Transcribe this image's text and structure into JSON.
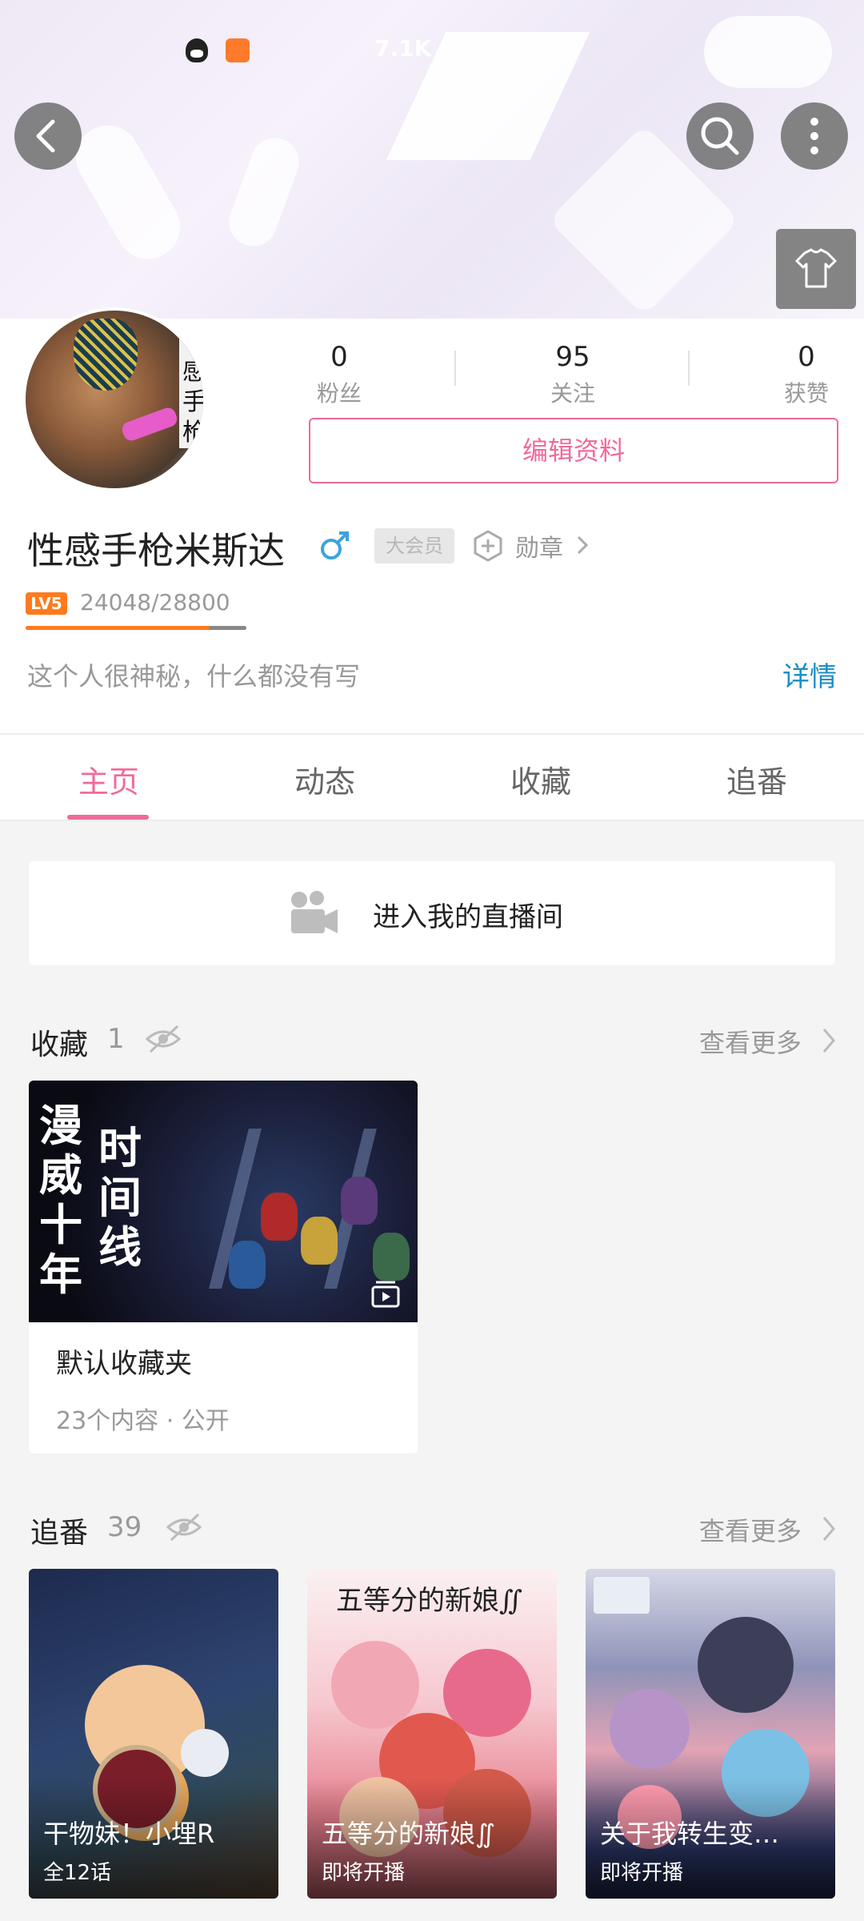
{
  "status_bar": {
    "text": "7.1K"
  },
  "profile": {
    "name": "性感手枪米斯达",
    "avatar_side_text": "♂感手枪",
    "stats": [
      {
        "value": "0",
        "label": "粉丝"
      },
      {
        "value": "95",
        "label": "关注"
      },
      {
        "value": "0",
        "label": "获赞"
      }
    ],
    "edit_label": "编辑资料",
    "vip_label": "大会员",
    "medal_label": "勋章",
    "level_label": "LV5",
    "exp_text": "24048/28800",
    "exp_progress": 0.835,
    "bio": "这个人很神秘，什么都没有写",
    "detail_label": "详情"
  },
  "tabs": [
    {
      "label": "主页",
      "active": true
    },
    {
      "label": "动态",
      "active": false
    },
    {
      "label": "收藏",
      "active": false
    },
    {
      "label": "追番",
      "active": false
    }
  ],
  "live": {
    "label": "进入我的直播间"
  },
  "favorites": {
    "title": "收藏",
    "count": "1",
    "see_more": "查看更多",
    "items": [
      {
        "cover_text_a": "漫威十年",
        "cover_text_b": "时间线",
        "name": "默认收藏夹",
        "meta": "23个内容 · 公开"
      }
    ]
  },
  "bangumi": {
    "title": "追番",
    "count": "39",
    "see_more": "查看更多",
    "items": [
      {
        "title": "干物妹！小埋R",
        "status": "全12话"
      },
      {
        "title": "五等分的新娘∬",
        "status": "即将开播",
        "cover_title": "五等分的新娘∬"
      },
      {
        "title": "关于我转生变…",
        "status": "即将开播"
      }
    ]
  },
  "colors": {
    "accent": "#f06a9b",
    "link": "#1b8ec8",
    "level": "#ff7a1e"
  }
}
